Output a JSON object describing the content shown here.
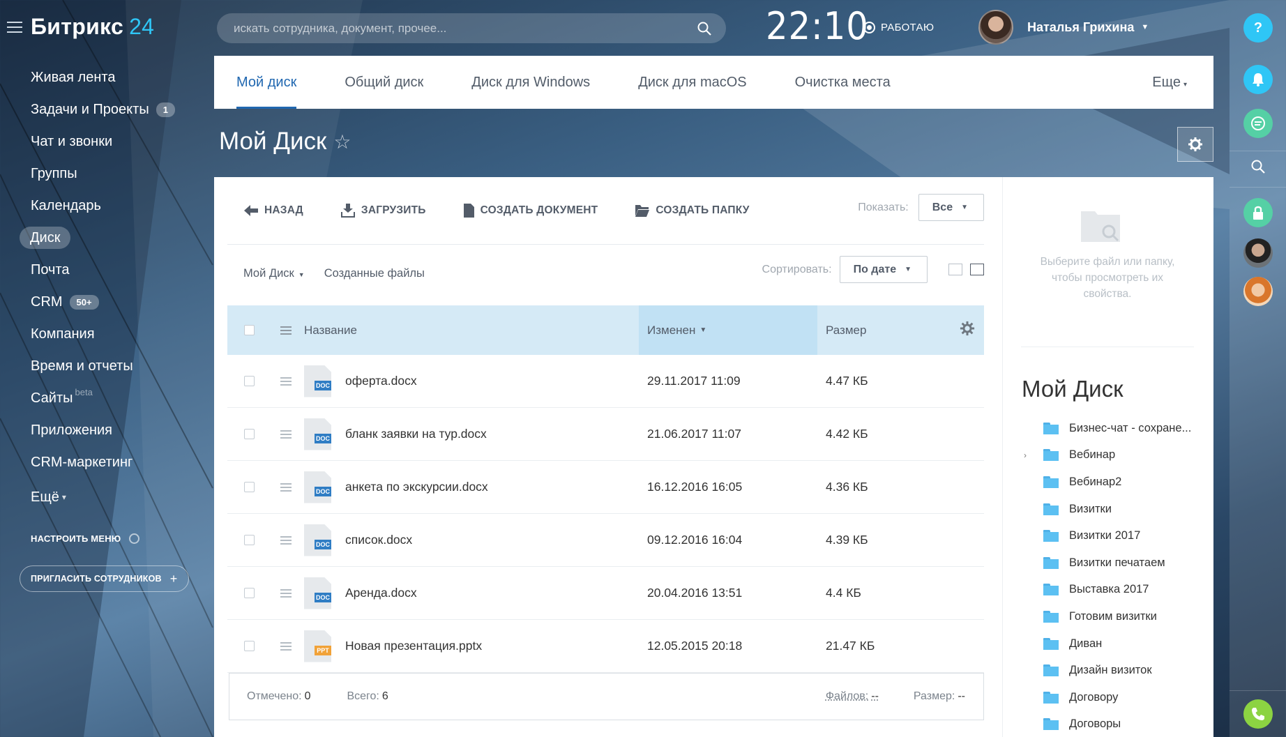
{
  "app": {
    "logo_name": "Битрикс",
    "logo_num": "24"
  },
  "sidebar": {
    "items": [
      {
        "label": "Живая лента",
        "counter": ""
      },
      {
        "label": "Задачи и Проекты",
        "counter": "1"
      },
      {
        "label": "Чат и звонки",
        "counter": ""
      },
      {
        "label": "Группы",
        "counter": ""
      },
      {
        "label": "Календарь",
        "counter": ""
      },
      {
        "label": "Диск",
        "counter": "",
        "active": true
      },
      {
        "label": "Почта",
        "counter": ""
      },
      {
        "label": "CRM",
        "counter": "50+"
      },
      {
        "label": "Компания",
        "counter": ""
      },
      {
        "label": "Время и отчеты",
        "counter": ""
      },
      {
        "label": "Сайты",
        "counter": "",
        "beta": "beta"
      },
      {
        "label": "Приложения",
        "counter": ""
      },
      {
        "label": "CRM-маркетинг",
        "counter": ""
      },
      {
        "label": "Ещё",
        "counter": ""
      }
    ],
    "configure_label": "НАСТРОИТЬ МЕНЮ",
    "invite_label": "ПРИГЛАСИТЬ СОТРУДНИКОВ"
  },
  "header": {
    "search_placeholder": "искать сотрудника, документ, прочее...",
    "clock": "22:10",
    "work_status": "РАБОТАЮ",
    "user_name": "Наталья Грихина"
  },
  "tabs": {
    "items": [
      "Мой диск",
      "Общий диск",
      "Диск для Windows",
      "Диск для macOS",
      "Очистка места"
    ],
    "active_index": 0,
    "more_label": "Еще"
  },
  "page": {
    "title": "Мой Диск",
    "star": "☆"
  },
  "toolbar": {
    "back": "НАЗАД",
    "upload": "ЗАГРУЗИТЬ",
    "create_doc": "СОЗДАТЬ ДОКУМЕНТ",
    "create_folder": "СОЗДАТЬ ПАПКУ",
    "show_label": "Показать:",
    "show_value": "Все"
  },
  "subbar": {
    "crumb": "Мой Диск",
    "created_files": "Созданные файлы",
    "sort_label": "Сортировать:",
    "sort_value": "По дате"
  },
  "grid": {
    "columns": {
      "name": "Название",
      "modified": "Изменен",
      "size": "Размер"
    },
    "rows": [
      {
        "name": "оферта.docx",
        "modified": "29.11.2017 11:09",
        "size": "4.47 КБ",
        "type": "DOC",
        "color": "#2f7dc4"
      },
      {
        "name": "бланк заявки на тур.docx",
        "modified": "21.06.2017 11:07",
        "size": "4.42 КБ",
        "type": "DOC",
        "color": "#2f7dc4"
      },
      {
        "name": "анкета по экскурсии.docx",
        "modified": "16.12.2016 16:05",
        "size": "4.36 КБ",
        "type": "DOC",
        "color": "#2f7dc4"
      },
      {
        "name": "список.docx",
        "modified": "09.12.2016 16:04",
        "size": "4.39 КБ",
        "type": "DOC",
        "color": "#2f7dc4"
      },
      {
        "name": "Аренда.docx",
        "modified": "20.04.2016 13:51",
        "size": "4.4 КБ",
        "type": "DOC",
        "color": "#2f7dc4"
      },
      {
        "name": "Новая презентация.pptx",
        "modified": "12.05.2015 20:18",
        "size": "21.47 КБ",
        "type": "PPT",
        "color": "#f1a238"
      }
    ]
  },
  "footer": {
    "marked_label": "Отмечено:",
    "marked_value": "0",
    "total_label": "Всего:",
    "total_value": "6",
    "files_label": "Файлов:",
    "files_value": "--",
    "size_label": "Размер:",
    "size_value": "--"
  },
  "info": {
    "empty_text": "Выберите файл или папку, чтобы просмотреть их свойства.",
    "tree_title": "Мой Диск",
    "folders": [
      {
        "label": "Бизнес-чат - сохране...",
        "expandable": false
      },
      {
        "label": "Вебинар",
        "expandable": true
      },
      {
        "label": "Вебинар2",
        "expandable": false
      },
      {
        "label": "Визитки",
        "expandable": false
      },
      {
        "label": "Визитки 2017",
        "expandable": false
      },
      {
        "label": "Визитки печатаем",
        "expandable": false
      },
      {
        "label": "Выставка 2017",
        "expandable": false
      },
      {
        "label": "Готовим визитки",
        "expandable": false
      },
      {
        "label": "Диван",
        "expandable": false
      },
      {
        "label": "Дизайн визиток",
        "expandable": false
      },
      {
        "label": "Договору",
        "expandable": false
      },
      {
        "label": "Договоры",
        "expandable": false
      }
    ]
  },
  "rail": {
    "help": "?",
    "colors": {
      "help": "#2fc6f6",
      "bell": "#2fc6f6",
      "chat": "#55d0a5",
      "lock": "#55d0a5",
      "phone": "#8cd342"
    }
  },
  "colors": {
    "accent": "#2067b0",
    "header_bg": "#d5eaf6",
    "sorted_col_bg": "#c1e1f4",
    "logo_num": "#2fc6f6"
  }
}
